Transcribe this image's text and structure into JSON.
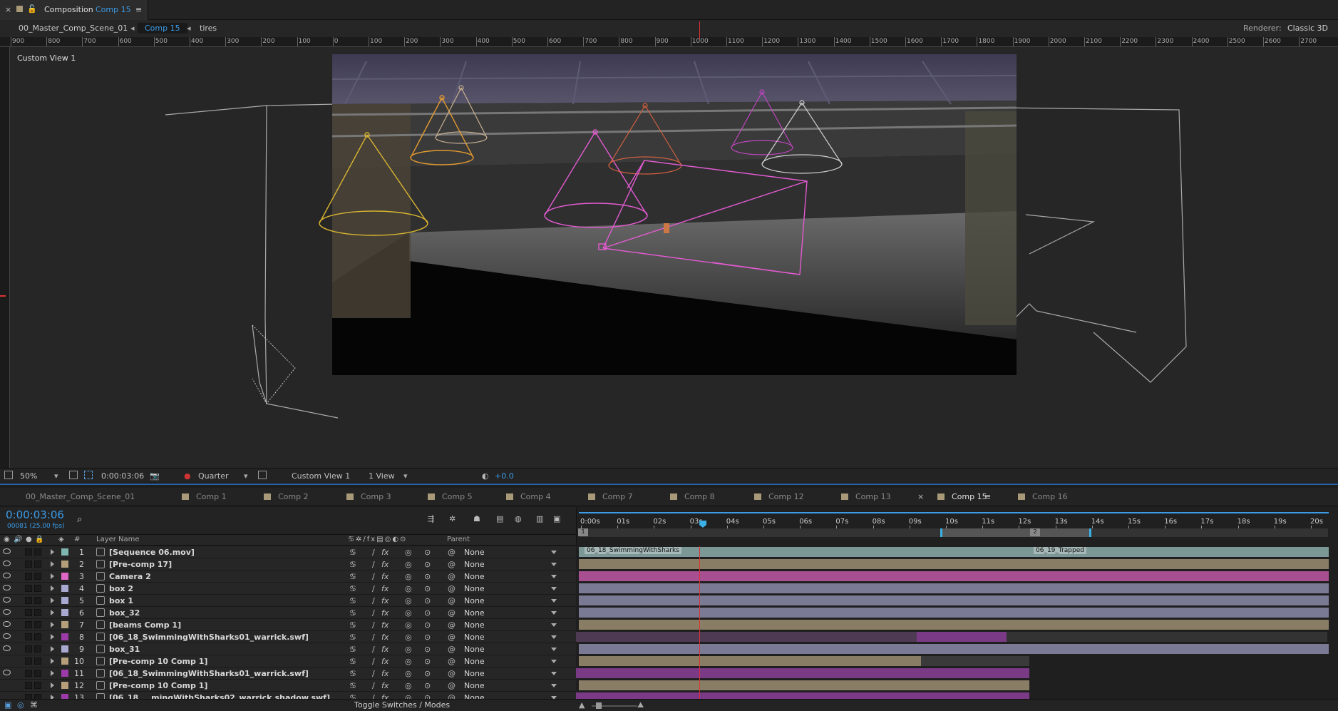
{
  "panel": {
    "close": "×",
    "label": "Composition",
    "comp": "Comp 15",
    "menu": "≡"
  },
  "breadcrumbs": [
    "00_Master_Comp_Scene_01",
    "Comp 15",
    "tires"
  ],
  "renderer": {
    "label": "Renderer:",
    "value": "Classic 3D"
  },
  "ruler_labels": [
    "900",
    "800",
    "700",
    "600",
    "500",
    "400",
    "300",
    "200",
    "100",
    "0",
    "100",
    "200",
    "300",
    "400",
    "500",
    "600",
    "700",
    "800",
    "900",
    "1000",
    "1100",
    "1200",
    "1300",
    "1400",
    "1500",
    "1600",
    "1700",
    "1800",
    "1900",
    "2000",
    "2100",
    "2200",
    "2300",
    "2400",
    "2500",
    "2600",
    "2700"
  ],
  "viewer": {
    "view_label": "Custom View 1"
  },
  "viewer_status": {
    "zoom": "50%",
    "timecode": "0:00:03:06",
    "resolution": "Quarter",
    "view": "Custom View 1",
    "layout": "1 View",
    "exposure": "+0.0"
  },
  "timeline_tabs": [
    "00_Master_Comp_Scene_01",
    "Comp 1",
    "Comp 2",
    "Comp 3",
    "Comp 5",
    "Comp 4",
    "Comp 7",
    "Comp 8",
    "Comp 12",
    "Comp 13",
    "Comp 15",
    "Comp 16"
  ],
  "active_tab": "Comp 15",
  "timeline": {
    "timecode": "0:00:03:06",
    "frame_info": "00081 (25.00 fps)",
    "search_placeholder": "",
    "col_num": "#",
    "col_layer_name": "Layer Name",
    "col_parent": "Parent",
    "ticks": [
      "0:00s",
      "01s",
      "02s",
      "03s",
      "04s",
      "05s",
      "06s",
      "07s",
      "08s",
      "09s",
      "10s",
      "11s",
      "12s",
      "13s",
      "14s",
      "15s",
      "16s",
      "17s",
      "18s",
      "19s",
      "20s"
    ],
    "markers": [
      {
        "label": "1"
      },
      {
        "label": "2"
      }
    ],
    "marker_labels": [
      "06_18_SwimmingWithSharks",
      "06_19_Trapped"
    ],
    "toggle": "Toggle Switches / Modes"
  },
  "layers": [
    {
      "num": "1",
      "name": "[Sequence 06.mov]",
      "parent": "None",
      "color": "#7fb6b2"
    },
    {
      "num": "2",
      "name": "[Pre-comp 17]",
      "parent": "None",
      "color": "#b59f7a"
    },
    {
      "num": "3",
      "name": "Camera 2",
      "parent": "None",
      "color": "#e066c6"
    },
    {
      "num": "4",
      "name": "box 2",
      "parent": "None",
      "color": "#a8a8d0"
    },
    {
      "num": "5",
      "name": "box 1",
      "parent": "None",
      "color": "#a8a8d0"
    },
    {
      "num": "6",
      "name": "box_32",
      "parent": "None",
      "color": "#a8a8d0"
    },
    {
      "num": "7",
      "name": "[beams Comp 1]",
      "parent": "None",
      "color": "#b59f7a"
    },
    {
      "num": "8",
      "name": "[06_18_SwimmingWithSharks01_warrick.swf]",
      "parent": "None",
      "color": "#9b3aa8"
    },
    {
      "num": "9",
      "name": "box_31",
      "parent": "None",
      "color": "#a8a8d0"
    },
    {
      "num": "10",
      "name": "[Pre-comp 10 Comp 1]",
      "parent": "None",
      "color": "#b59f7a"
    },
    {
      "num": "11",
      "name": "[06_18_SwimmingWithSharks01_warrick.swf]",
      "parent": "None",
      "color": "#9b3aa8"
    },
    {
      "num": "12",
      "name": "[Pre-comp 10 Comp 1]",
      "parent": "None",
      "color": "#b59f7a"
    },
    {
      "num": "13",
      "name": "[06_18_...mingWithSharks02_warrick.shadow.swf]",
      "parent": "None",
      "color": "#9b3aa8"
    }
  ],
  "colors": {
    "accent": "#3b9be6",
    "pink": "#e25bd0",
    "yellow": "#d8b530",
    "orange": "#e29a30"
  }
}
